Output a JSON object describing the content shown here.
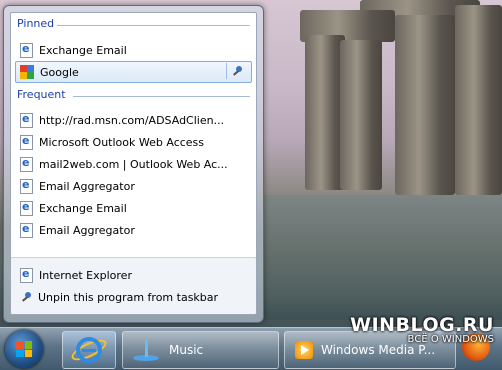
{
  "jumplist": {
    "pinned_header": "Pinned",
    "pinned_items": [
      {
        "label": "Exchange Email",
        "icon": "ie-page-icon"
      },
      {
        "label": "Google",
        "icon": "google-icon",
        "selected": true
      }
    ],
    "frequent_header": "Frequent",
    "frequent_items": [
      {
        "label": "http://rad.msn.com/ADSAdClien..."
      },
      {
        "label": "Microsoft Outlook Web Access"
      },
      {
        "label": "mail2web.com | Outlook Web Ac..."
      },
      {
        "label": "Email Aggregator"
      },
      {
        "label": "Exchange Email"
      },
      {
        "label": "Email Aggregator"
      }
    ],
    "tasks": [
      {
        "label": "Internet Explorer",
        "icon": "internet-explorer-icon"
      },
      {
        "label": "Unpin this program from taskbar",
        "icon": "unpin-icon"
      }
    ]
  },
  "taskbar": {
    "music_label": "Music",
    "wmp_label": "Windows Media P..."
  },
  "watermark": {
    "line1": "WINBLOG.RU",
    "line2": "ВСЁ О WINDOWS"
  }
}
